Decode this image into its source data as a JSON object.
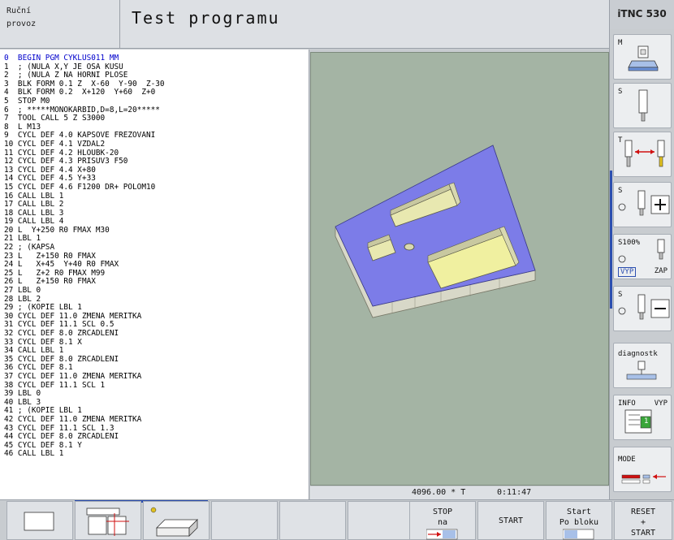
{
  "header": {
    "mode_line1": "Ruční",
    "mode_line2": "provoz",
    "title": "Test programu",
    "brand": "iTNC 530"
  },
  "program_lines": [
    "0  BEGIN PGM CYKLUS011 MM",
    "1  ; (NULA X,Y JE OSA KUSU",
    "2  ; (NULA Z NA HORNI PLOSE",
    "3  BLK FORM 0.1 Z  X-60  Y-90  Z-30",
    "4  BLK FORM 0.2  X+120  Y+60  Z+0",
    "5  STOP M0",
    "6  ; *****MONOKARBID,D=8,L=20*****",
    "7  TOOL CALL 5 Z S3000",
    "8  L M13",
    "9  CYCL DEF 4.0 KAPSOVE FREZOVANI",
    "10 CYCL DEF 4.1 VZDAL2",
    "11 CYCL DEF 4.2 HLOUBK-20",
    "12 CYCL DEF 4.3 PRISUV3 F50",
    "13 CYCL DEF 4.4 X+80",
    "14 CYCL DEF 4.5 Y+33",
    "15 CYCL DEF 4.6 F1200 DR+ POLOM10",
    "16 CALL LBL 1",
    "17 CALL LBL 2",
    "18 CALL LBL 3",
    "19 CALL LBL 4",
    "20 L  Y+250 R0 FMAX M30",
    "21 LBL 1",
    "22 ; (KAPSA",
    "23 L   Z+150 R0 FMAX",
    "24 L   X+45  Y+40 R0 FMAX",
    "25 L   Z+2 R0 FMAX M99",
    "26 L   Z+150 R0 FMAX",
    "27 LBL 0",
    "28 LBL 2",
    "29 ; (KOPIE LBL 1",
    "30 CYCL DEF 11.0 ZMENA MERITKA",
    "31 CYCL DEF 11.1 SCL 0.5",
    "32 CYCL DEF 8.0 ZRCADLENI",
    "33 CYCL DEF 8.1 X",
    "34 CALL LBL 1",
    "35 CYCL DEF 8.0 ZRCADLENI",
    "36 CYCL DEF 8.1",
    "37 CYCL DEF 11.0 ZMENA MERITKA",
    "38 CYCL DEF 11.1 SCL 1",
    "39 LBL 0",
    "40 LBL 3",
    "41 ; (KOPIE LBL 1",
    "42 CYCL DEF 11.0 ZMENA MERITKA",
    "43 CYCL DEF 11.1 SCL 1.3",
    "44 CYCL DEF 8.0 ZRCADLENI",
    "45 CYCL DEF 8.1 Y",
    "46 CALL LBL 1"
  ],
  "status": {
    "feed": "4096.00 * T",
    "time": "0:11:47"
  },
  "sidebar": {
    "m": "M",
    "s": "S",
    "t": "T",
    "s_plus": "S",
    "s100": "S100%",
    "vyp": "VYP",
    "zap": "ZAP",
    "s_minus": "S",
    "diagnostika": "diagnostk",
    "info": "INFO",
    "info_vyp": "VYP",
    "info_num": "1",
    "mode": "MODE"
  },
  "softkeys": {
    "stop": "STOP",
    "stop_2": "na",
    "start": "START",
    "start_block_1": "Start",
    "start_block_2": "Po bloku",
    "reset_1": "RESET",
    "reset_2": "+",
    "reset_3": "START"
  },
  "colors": {
    "workpiece_top": "#7c7ce8",
    "pocket": "#f0f0a0",
    "side": "#d8d8c8",
    "background_3d": "#a4b4a4"
  }
}
